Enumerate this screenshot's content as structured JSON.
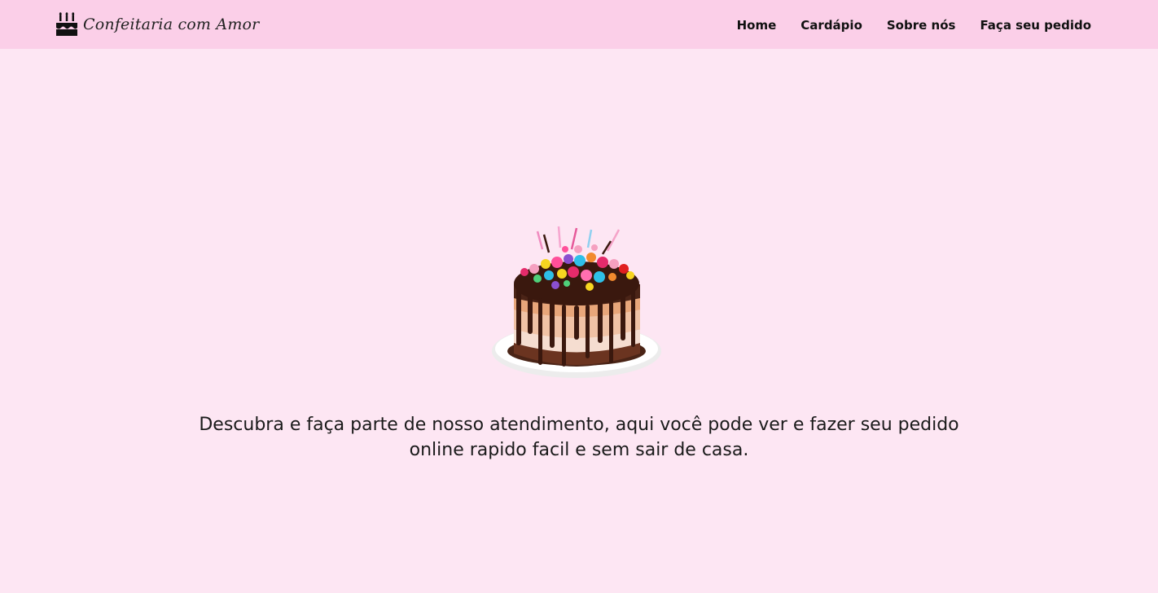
{
  "header": {
    "brand": {
      "name": "Confeitaria com Amor",
      "icon": "birthday-cake-icon"
    },
    "nav": [
      {
        "label": "Home"
      },
      {
        "label": "Cardápio"
      },
      {
        "label": "Sobre nós"
      },
      {
        "label": "Faça seu pedido"
      }
    ]
  },
  "hero": {
    "image": "chocolate-drip-cake-image",
    "text": "Descubra e faça parte de nosso atendimento, aqui você pode ver e fazer seu pedido online rapido facil e sem sair de casa."
  },
  "colors": {
    "page_background": "#fde6f3",
    "navbar_background": "#fbcfe8",
    "text": "#111111"
  }
}
